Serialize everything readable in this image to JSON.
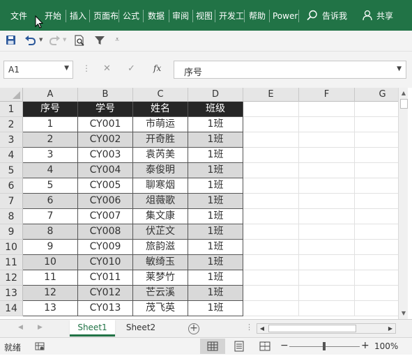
{
  "ribbon": {
    "tabs": [
      "文件",
      "开始",
      "插入",
      "页面布",
      "公式",
      "数据",
      "审阅",
      "视图",
      "开发工",
      "帮助",
      "Power"
    ],
    "tell_me": "告诉我",
    "share": "共享"
  },
  "formula_bar": {
    "name_box": "A1",
    "fx": "fx",
    "value": "序号"
  },
  "columns": [
    "A",
    "B",
    "C",
    "D",
    "E",
    "F",
    "G"
  ],
  "row_numbers": [
    "1",
    "2",
    "3",
    "4",
    "5",
    "6",
    "7",
    "8",
    "9",
    "10",
    "11",
    "12",
    "13",
    "14"
  ],
  "table": {
    "headers": [
      "序号",
      "学号",
      "姓名",
      "班级"
    ],
    "rows": [
      [
        "1",
        "CY001",
        "市萌运",
        "1班"
      ],
      [
        "2",
        "CY002",
        "开奇胜",
        "1班"
      ],
      [
        "3",
        "CY003",
        "袁芮美",
        "1班"
      ],
      [
        "4",
        "CY004",
        "泰俊明",
        "1班"
      ],
      [
        "5",
        "CY005",
        "聊寒烟",
        "1班"
      ],
      [
        "6",
        "CY006",
        "俎薇歌",
        "1班"
      ],
      [
        "7",
        "CY007",
        "集文康",
        "1班"
      ],
      [
        "8",
        "CY008",
        "伏芷文",
        "1班"
      ],
      [
        "9",
        "CY009",
        "旅韵滋",
        "1班"
      ],
      [
        "10",
        "CY010",
        "敏绮玉",
        "1班"
      ],
      [
        "11",
        "CY011",
        "莱梦竹",
        "1班"
      ],
      [
        "12",
        "CY012",
        "芒云溪",
        "1班"
      ],
      [
        "13",
        "CY013",
        "茂飞英",
        "1班"
      ]
    ]
  },
  "sheets": [
    "Sheet1",
    "Sheet2"
  ],
  "active_sheet": "Sheet1",
  "status": {
    "ready": "就绪",
    "zoom": "100%"
  },
  "colors": {
    "accent": "#217346",
    "header_fill": "#262626",
    "alt_row_fill": "#d9d9d9"
  }
}
